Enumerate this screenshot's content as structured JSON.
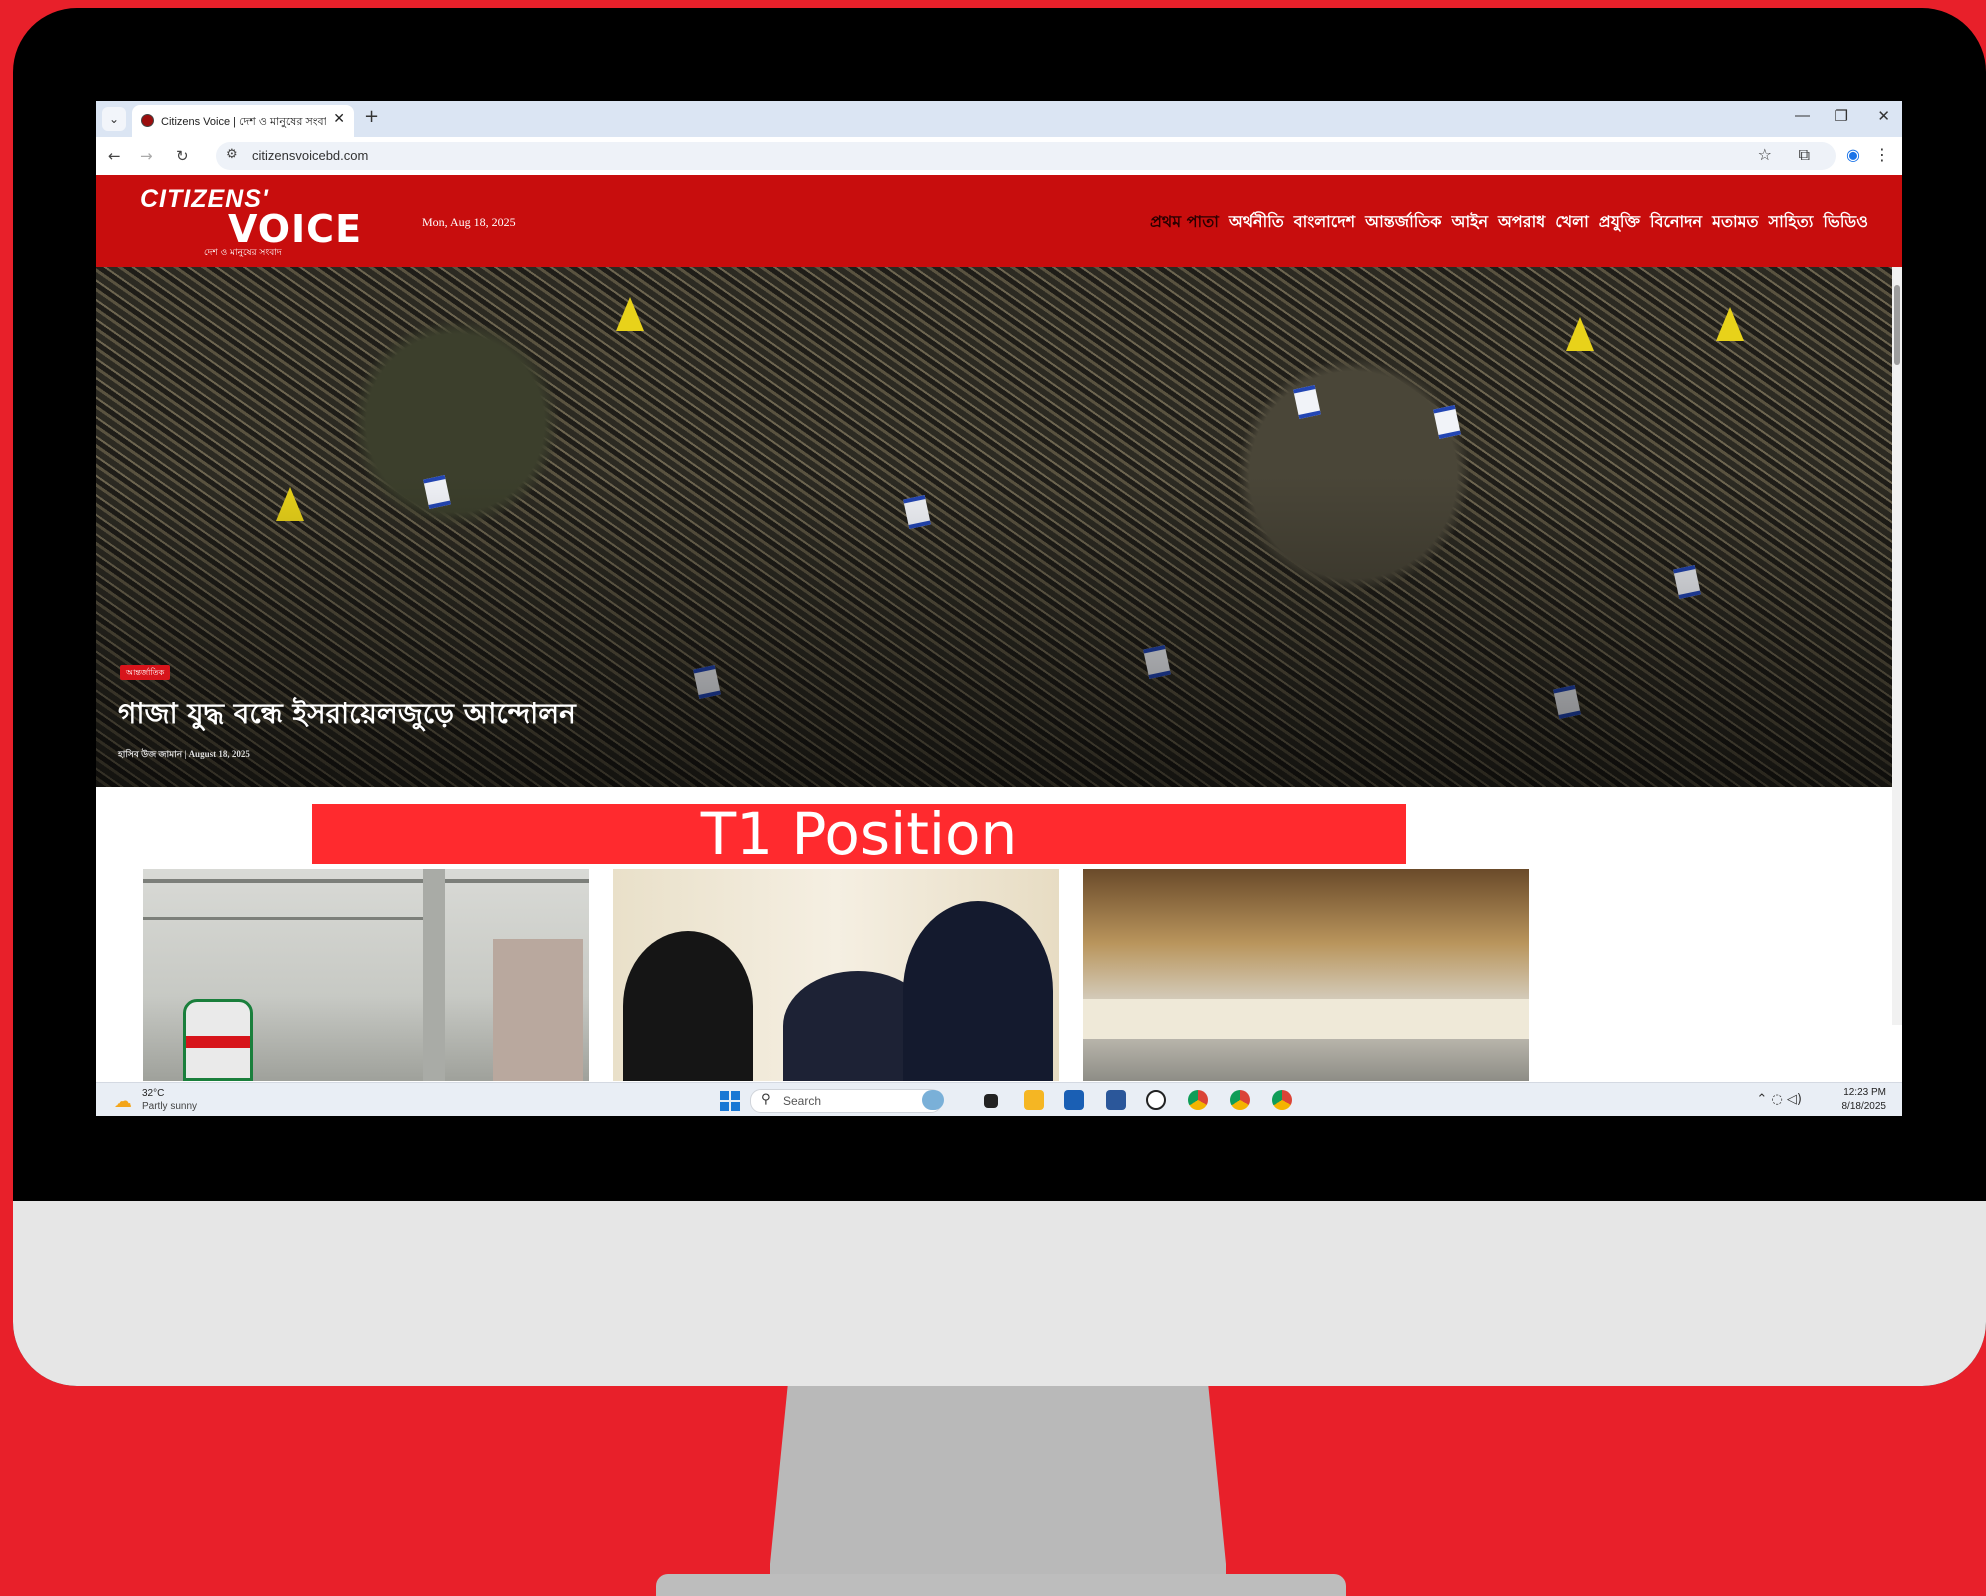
{
  "browser": {
    "tab_title": "Citizens Voice | দেশ ও মানুষের সংবাদ",
    "url": "citizensvoicebd.com"
  },
  "site": {
    "logo_top": "CITIZENS'",
    "logo_main": "VOICE",
    "logo_tagline": "দেশ ও মানুষের সংবাদ",
    "date": "Mon, Aug 18, 2025",
    "nav": [
      "প্রথম পাতা",
      "অর্থনীতি",
      "বাংলাদেশ",
      "আন্তর্জাতিক",
      "আইন",
      "অপরাধ",
      "খেলা",
      "প্রযুক্তি",
      "বিনোদন",
      "মতামত",
      "সাহিত্য",
      "ভিডিও"
    ]
  },
  "hero": {
    "category": "আন্তর্জাতিক",
    "headline": "গাজা যুদ্ধ বন্ধে ইসরায়েলজুড়ে আন্দোলন",
    "author": "হাসিব উজ জামান",
    "date": "August 18, 2025"
  },
  "overlay": {
    "banner": "T1 Position"
  },
  "taskbar": {
    "temperature": "32°C",
    "weather": "Partly sunny",
    "search_placeholder": "Search",
    "time": "12:23 PM",
    "date": "8/18/2025"
  },
  "colors": {
    "brand_red": "#c80d0d",
    "background_red": "#e8202a",
    "banner_red": "#ff2a2e"
  }
}
